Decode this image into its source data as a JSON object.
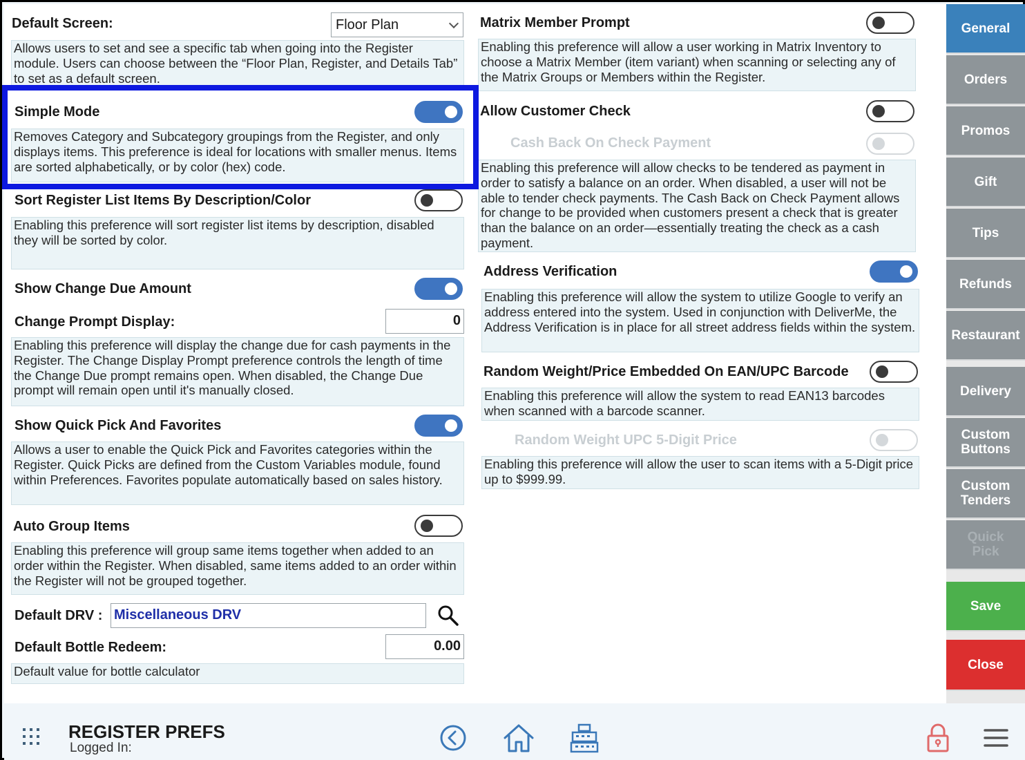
{
  "colors": {
    "accent_blue": "#3f75c1",
    "highlight": "#0d19e0",
    "tab_active": "#3a81bb",
    "tab_inactive": "#8e9599",
    "save": "#4cb04c",
    "close": "#dc2f2f",
    "desc_bg": "#ebf4f7"
  },
  "left": {
    "default_screen": {
      "label": "Default Screen:",
      "value": "Floor Plan",
      "desc": "Allows users to set and see a specific tab when going into the Register module. Users can choose between the “Floor Plan, Register, and Details Tab” to set as a default screen."
    },
    "simple_mode": {
      "label": "Simple Mode",
      "on": true,
      "desc": "Removes Category and Subcategory groupings from the Register, and only displays items. This preference is ideal for locations with smaller menus. Items are sorted alphabetically, or by color (hex) code."
    },
    "sort_register": {
      "label": "Sort Register List Items By Description/Color",
      "on": false,
      "desc": "Enabling this preference will sort register list items by description, disabled they will be sorted by color."
    },
    "show_change_due": {
      "label": "Show Change Due Amount",
      "on": true
    },
    "change_prompt": {
      "label": "Change Prompt Display:",
      "value": "0",
      "desc": "Enabling this preference will display the change due for cash payments in the Register. The Change Display Prompt preference controls the length of time the Change Due prompt remains open. When disabled, the Change Due prompt will remain open until it's manually closed."
    },
    "quick_pick": {
      "label": "Show Quick Pick And Favorites",
      "on": true,
      "desc": "Allows a user to enable the Quick Pick and Favorites categories within the Register. Quick Picks are defined from the Custom Variables module, found within Preferences. Favorites populate automatically based on sales history."
    },
    "auto_group": {
      "label": "Auto Group Items",
      "on": false,
      "desc": "Enabling this preference will group same items together when added to an order within the Register. When disabled, same items added to an order within the Register will not be grouped together."
    },
    "default_drv": {
      "label": "Default DRV :",
      "value": "Miscellaneous DRV"
    },
    "bottle_redeem": {
      "label": "Default Bottle Redeem:",
      "value": "0.00",
      "desc": "Default value for bottle calculator"
    }
  },
  "right": {
    "matrix": {
      "label": "Matrix Member Prompt",
      "on": false,
      "desc": "Enabling this preference will allow a user working in Matrix Inventory to choose a Matrix Member (item variant) when scanning or selecting any of the Matrix Groups or Members within the Register."
    },
    "customer_check": {
      "label": "Allow Customer Check",
      "on": false,
      "sub_label": "Cash Back On Check Payment",
      "desc": "Enabling this preference will allow checks to be tendered as payment in order to satisfy a balance on an order. When disabled, a user will not be able to tender check payments. The Cash Back on Check Payment allows for change to be provided when customers present a check that is greater than the balance on an order—essentially treating the check as a cash payment."
    },
    "address": {
      "label": "Address Verification",
      "on": true,
      "desc": "Enabling this preference will allow the system to utilize Google to verify an address entered into the system. Used in conjunction with DeliverMe, the Address Verification is in place for all street address fields within the system."
    },
    "random_weight": {
      "label": "Random Weight/Price Embedded On EAN/UPC Barcode",
      "on": false,
      "desc": "Enabling this preference will allow the system to read EAN13 barcodes when scanned with a barcode scanner."
    },
    "upc5": {
      "label": "Random Weight UPC 5-Digit Price",
      "desc": "Enabling this preference will allow the user to scan items with a 5-Digit price up to $999.99."
    }
  },
  "sidebar": {
    "tabs": [
      "General",
      "Orders",
      "Promos",
      "Gift",
      "Tips",
      "Refunds",
      "Restaurant",
      "Delivery",
      "Custom Buttons",
      "Custom Tenders",
      "Quick Pick"
    ],
    "save": "Save",
    "close": "Close"
  },
  "bottom": {
    "title": "REGISTER PREFS",
    "subtitle": "Logged In:",
    "icons": [
      "apps-grid-icon",
      "back-icon",
      "home-icon",
      "register-icon",
      "lock-icon",
      "menu-icon"
    ]
  }
}
